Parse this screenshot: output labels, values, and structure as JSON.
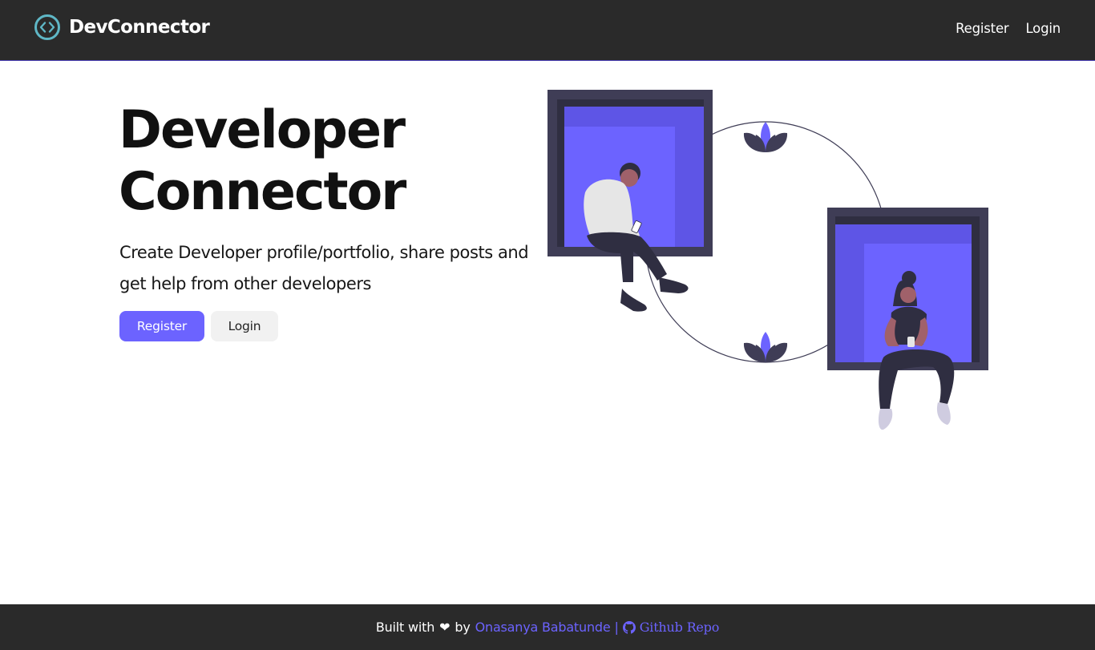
{
  "navbar": {
    "brand": "DevConnector",
    "brand_icon": "code-circle-icon",
    "links": [
      {
        "label": "Register"
      },
      {
        "label": "Login"
      }
    ]
  },
  "hero": {
    "title_line1": "Developer",
    "title_line2": "Connector",
    "subtitle": "Create Developer profile/portfolio, share posts and get help from other developers",
    "register_button": "Register",
    "login_button": "Login"
  },
  "footer": {
    "built_with": "Built with",
    "heart": "❤",
    "by": "by",
    "author": "Onasanya Babatunde",
    "separator": "|",
    "repo_label": "Github Repo",
    "repo_icon": "github-icon"
  },
  "colors": {
    "accent": "#6c63ff",
    "dark": "#2a2a2a",
    "frame": "#3f3d56"
  }
}
